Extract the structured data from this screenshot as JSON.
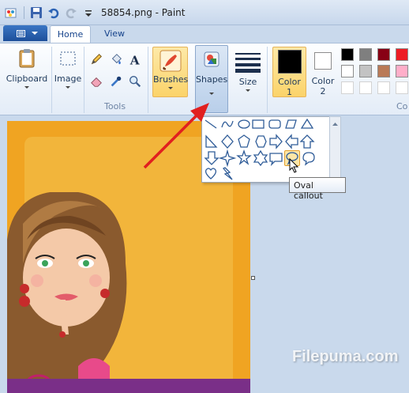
{
  "title": "58854.png - Paint",
  "tabs": {
    "home": "Home",
    "view": "View"
  },
  "ribbon": {
    "clipboard": "Clipboard",
    "image": "Image",
    "tools_group": "Tools",
    "brushes": "Brushes",
    "shapes": "Shapes",
    "size": "Size",
    "color1": "Color",
    "color1_num": "1",
    "color2": "Color",
    "color2_num": "2",
    "colors_group": "Co"
  },
  "palette": [
    "#000000",
    "#7f7f7f",
    "#880015",
    "#ed1c24",
    "#ffffff",
    "#c3c3c3",
    "#b97a57",
    "#ffaec9"
  ],
  "shapes_gallery": [
    "line-shape",
    "curve-shape",
    "oval-shape",
    "rectangle-shape",
    "rounded-rectangle-shape",
    "polygon-shape",
    "triangle-shape",
    "right-triangle-shape",
    "diamond-shape",
    "pentagon-shape",
    "hexagon-shape",
    "right-arrow-shape",
    "left-arrow-shape",
    "up-arrow-shape",
    "down-arrow-shape",
    "four-point-star-shape",
    "five-point-star-shape",
    "six-point-star-shape",
    "rounded-rectangle-callout-shape",
    "oval-callout-shape",
    "cloud-callout-shape",
    "heart-shape",
    "lightning-shape"
  ],
  "tooltip": "Oval callout",
  "watermark": "Filepuma.com"
}
